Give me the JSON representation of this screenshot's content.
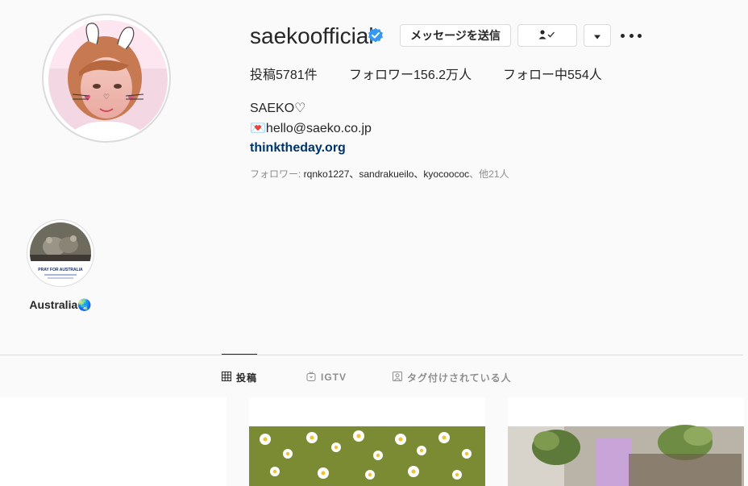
{
  "profile": {
    "username": "saekoofficial",
    "verified_icon": "verified-badge-icon",
    "buttons": {
      "message": "メッセージを送信",
      "follow_icon": "person-check-icon",
      "dropdown_icon": "caret-down-icon",
      "more_icon": "more-horizontal-icon"
    },
    "stats": {
      "posts_label": "投稿",
      "posts_value": "5781",
      "posts_suffix": "件",
      "followers_label": "フォロワー",
      "followers_value": "156.2万",
      "followers_suffix": "人",
      "following_label": "フォロー中",
      "following_value": "554",
      "following_suffix": "人"
    },
    "bio": {
      "name": "SAEKO♡",
      "email_line": "💌hello@saeko.co.jp",
      "link": "thinktheday.org"
    },
    "followed_by": {
      "prefix": "フォロワー: ",
      "names": "rqnko1227、sandrakueilo、kyocoococ",
      "suffix": "、他21人"
    }
  },
  "highlights": [
    {
      "label": "Australia🌏",
      "image_caption": "PRAY FOR AUSTRALIA"
    }
  ],
  "tabs": [
    {
      "label": "投稿",
      "icon": "grid-icon",
      "active": true
    },
    {
      "label": "IGTV",
      "icon": "igtv-icon",
      "active": false
    },
    {
      "label": "タグ付けされている人",
      "icon": "tagged-icon",
      "active": false
    }
  ],
  "colors": {
    "background": "#fafafa",
    "border": "#dbdbdb",
    "text": "#262626",
    "muted": "#8e8e8e",
    "link": "#003569",
    "verified": "#3897f0"
  }
}
